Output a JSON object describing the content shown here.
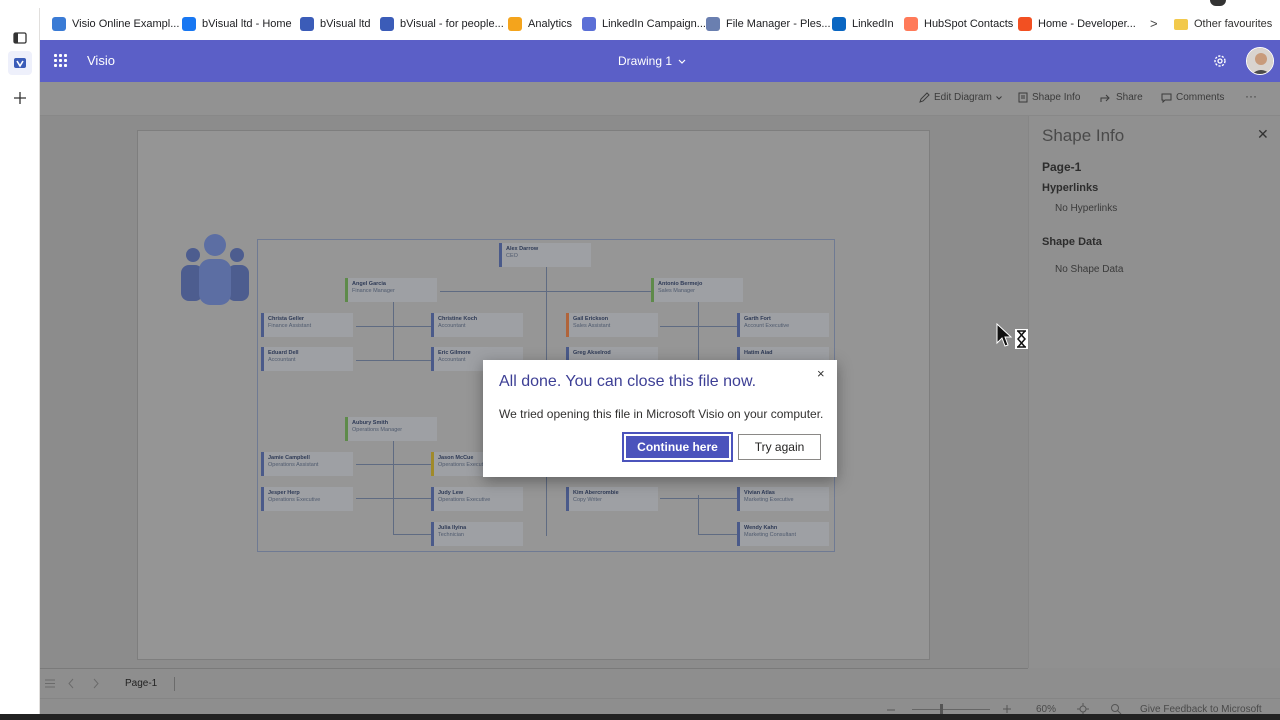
{
  "bookmarks": [
    {
      "label": "Visio Online Exampl...",
      "icon": "visio-icon",
      "color": "#3a7bd5"
    },
    {
      "label": "bVisual ltd - Home",
      "icon": "facebook-icon",
      "color": "#1877f2"
    },
    {
      "label": "bVisual ltd",
      "icon": "bvisual-icon",
      "color": "#3b5cb8"
    },
    {
      "label": "bVisual - for people...",
      "icon": "bvisual-icon",
      "color": "#3b5cb8"
    },
    {
      "label": "Analytics",
      "icon": "analytics-icon",
      "color": "#f4a41c"
    },
    {
      "label": "LinkedIn Campaign...",
      "icon": "linkedin-campaign-icon",
      "color": "#5b6fd6"
    },
    {
      "label": "File Manager - Ples...",
      "icon": "file-manager-icon",
      "color": "#6a7fb0"
    },
    {
      "label": "LinkedIn",
      "icon": "linkedin-icon",
      "color": "#0a66c2"
    },
    {
      "label": "HubSpot Contacts",
      "icon": "hubspot-icon",
      "color": "#ff7a59"
    },
    {
      "label": "Home - Developer...",
      "icon": "microsoft-icon",
      "color": "#f25022"
    }
  ],
  "bookmarks_more": ">",
  "other_favourites": "Other favourites",
  "app": {
    "title": "Visio",
    "document": "Drawing 1"
  },
  "toolbar": {
    "edit": "Edit Diagram",
    "shape_info": "Shape Info",
    "share": "Share",
    "comments": "Comments",
    "more": "···"
  },
  "org": {
    "nodes": [
      {
        "name": "Alex Darrow",
        "role": "CEO"
      },
      {
        "name": "Angel Garcia",
        "role": "Finance Manager"
      },
      {
        "name": "Antonio Bermejo",
        "role": "Sales Manager"
      },
      {
        "name": "Christa Geller",
        "role": "Finance Assistant"
      },
      {
        "name": "Christine Koch",
        "role": "Accountant"
      },
      {
        "name": "Gail Erickson",
        "role": "Sales Assistant"
      },
      {
        "name": "Garth Fort",
        "role": "Account Executive"
      },
      {
        "name": "Eduard Dell",
        "role": "Accountant"
      },
      {
        "name": "Eric Gilmore",
        "role": "Accountant"
      },
      {
        "name": "Greg Akselrod",
        "role": ""
      },
      {
        "name": "Hatim Aiad",
        "role": ""
      },
      {
        "name": "Aubury Smith",
        "role": "Operations Manager"
      },
      {
        "name": "Jamie Campbell",
        "role": "Operations Assistant"
      },
      {
        "name": "Jason McCue",
        "role": "Operations Executive"
      },
      {
        "name": "Jesper Herp",
        "role": "Operations Executive"
      },
      {
        "name": "Judy Lew",
        "role": "Operations Executive"
      },
      {
        "name": "Kim Abercrombie",
        "role": "Copy Writer"
      },
      {
        "name": "Vivian Atlas",
        "role": "Marketing Executive"
      },
      {
        "name": "Julia Ilyina",
        "role": "Technician"
      },
      {
        "name": "Wendy Kahn",
        "role": "Marketing Consultant"
      }
    ]
  },
  "shape_info": {
    "title": "Shape Info",
    "close": "✕",
    "page": "Page-1",
    "hyperlinks_label": "Hyperlinks",
    "hyperlinks_value": "No Hyperlinks",
    "shapedata_label": "Shape Data",
    "shapedata_value": "No Shape Data"
  },
  "page_tab": "Page-1",
  "status": {
    "zoom": "60%",
    "feedback": "Give Feedback to Microsoft",
    "zoom_level": 0.6
  },
  "dialog": {
    "title": "All done. You can close this file now.",
    "message": "We tried opening this file in Microsoft Visio on your computer.",
    "continue": "Continue here",
    "try_again": "Try again",
    "close": "×"
  }
}
